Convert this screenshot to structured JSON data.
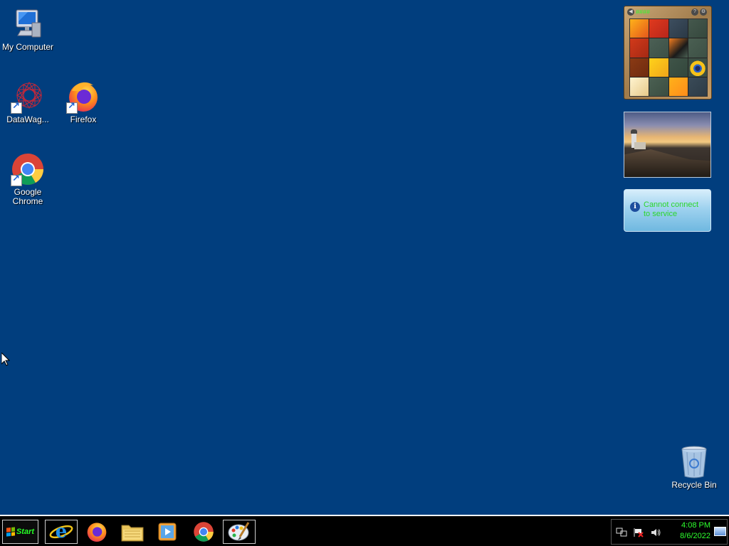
{
  "desktop": {
    "icons": [
      {
        "label": "My Computer",
        "icon": "computer-icon"
      },
      {
        "label": "DataWag...",
        "icon": "datawagon-icon",
        "shortcut": true
      },
      {
        "label": "Firefox",
        "icon": "firefox-icon",
        "shortcut": true
      },
      {
        "label": "Google\nChrome",
        "icon": "chrome-icon",
        "shortcut": true
      },
      {
        "label": "Recycle Bin",
        "icon": "recycle-bin-icon"
      }
    ]
  },
  "gadgets": {
    "puzzle": {
      "title": "####",
      "back_icon": "back-icon",
      "help_icon": "help-icon",
      "options_icon": "options-icon"
    },
    "slideshow": {
      "subject": "lighthouse-photo"
    },
    "weather": {
      "message": "Cannot connect to service",
      "info_icon": "info-icon"
    }
  },
  "taskbar": {
    "start_label": "Start",
    "pinned": [
      {
        "name": "internet-explorer",
        "icon": "internet-explorer-icon"
      },
      {
        "name": "firefox",
        "icon": "firefox-icon"
      },
      {
        "name": "file-explorer",
        "icon": "folder-icon"
      },
      {
        "name": "media-player",
        "icon": "media-player-icon"
      },
      {
        "name": "chrome",
        "icon": "chrome-icon"
      },
      {
        "name": "paint",
        "icon": "paint-icon"
      }
    ],
    "tray": {
      "icons": [
        "network-icon",
        "action-center-flag-icon",
        "volume-icon"
      ],
      "time": "4:08 PM",
      "date": "8/6/2022"
    }
  },
  "colors": {
    "desktop_bg": "#013e7e",
    "taskbar_bg": "#000000",
    "clock_text": "#2eff2e",
    "weather_text": "#2bd62b"
  }
}
